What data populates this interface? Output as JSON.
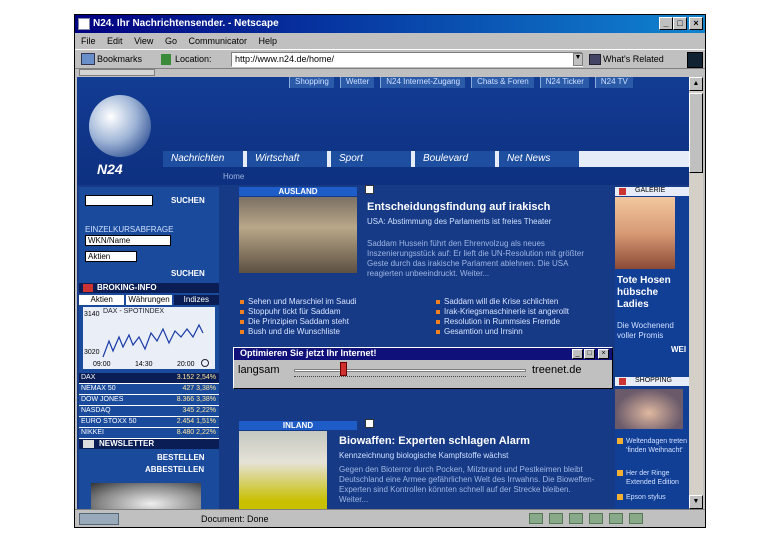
{
  "window": {
    "title": "N24. Ihr Nachrichtensender. - Netscape"
  },
  "menubar": [
    "File",
    "Edit",
    "View",
    "Go",
    "Communicator",
    "Help"
  ],
  "toolbar": {
    "bookmarks": "Bookmarks",
    "location_label": "Location:",
    "url": "http://www.n24.de/home/",
    "whats_related": "What's Related"
  },
  "statusbar": {
    "status": "Document: Done"
  },
  "site": {
    "logo": "N24",
    "top_links": [
      "Shopping",
      "Wetter",
      "N24 Internet-Zugang",
      "Chats & Foren",
      "N24 Ticker",
      "N24 TV"
    ],
    "main_nav": [
      "Nachrichten",
      "Wirtschaft",
      "Sport",
      "Boulevard",
      "Net News"
    ],
    "breadcrumb": "Home"
  },
  "left": {
    "search_button": "SUCHEN",
    "depot_label": "EINZELKURSABFRAGE",
    "depot_placeholder": "WKN/Name",
    "select_value": "Aktien",
    "search_button2": "SUCHEN",
    "broking_title": "BROKING-INFO",
    "broking_tabs": [
      "Aktien",
      "Währungen",
      "Indizes"
    ],
    "chart_title": "DAX - SPOTINDEX",
    "chart_y": [
      "3140",
      "3020"
    ],
    "chart_x": [
      "09:00",
      "14:30",
      "20:00"
    ],
    "ticker": [
      {
        "name": "DAX",
        "value": "3.152  2,54%"
      },
      {
        "name": "NEMAX 50",
        "value": "427  3,38%"
      },
      {
        "name": "DOW JONES",
        "value": "8.366  3,38%"
      },
      {
        "name": "NASDAQ",
        "value": "345  2,22%"
      },
      {
        "name": "EURO STOXX 50",
        "value": "2.454  1,51%"
      },
      {
        "name": "NIKKEI",
        "value": "8.480  2,22%"
      }
    ],
    "newsletter_title": "NEWSLETTER",
    "order_label": "BESTELLEN",
    "cancel_label": "ABBESTELLEN"
  },
  "article1": {
    "section": "AUSLAND",
    "headline": "Entscheidungsfindung auf irakisch",
    "sub": "USA: Abstimmung des Parlaments ist freies Theater",
    "body": "Saddam Hussein führt den Ehrenvolzug als neues Inszenierungsstück auf: Er lieft die UN-Resolution mit größter Geste durch das irakische Parlament ablehnen. Die USA reagierten unbeeindruckt. Weiter...",
    "links": [
      "Sehen und Marschiel im Saudi",
      "Saddam will die Krise schlichten",
      "Stoppuhr tickt für Saddam",
      "Irak-Kriegsmaschinerie ist angerollt",
      "Die Prinzipien Saddam steht",
      "Resolution in Rummsies Fremde",
      "Bush und die Wunschliste",
      "Gesamtion und Irrsinn"
    ]
  },
  "popup": {
    "title": "Optimieren Sie jetzt Ihr Internet!",
    "label": "langsam",
    "brand": "treenet.de"
  },
  "article2": {
    "section": "INLAND",
    "headline": "Biowaffen: Experten schlagen Alarm",
    "sub": "Kennzeichnung biologische Kampfstoffe wächst",
    "body": "Gegen den Bioterror durch Pocken, Milzbrand und Pestkeimen bleibt Deutschland eine Armee gefährlichen Welt des Irrwahns. Die Bioweffen-Experten sind Kontrollen könnten schnell auf der Strecke bleiben. Weiter..."
  },
  "right": {
    "gallery_label": "GALERIE",
    "gallery_title": "Tote Hosen hübsche Ladies",
    "gallery_text": "Die Wochenend voller Promis",
    "gallery_more": "WEI",
    "shopping_label": "SHOPPING",
    "shop_items": [
      "Weltendagen treten 'finden Weihnacht'",
      "Her der Ringe Extended Edition",
      "Epson stylus"
    ]
  }
}
